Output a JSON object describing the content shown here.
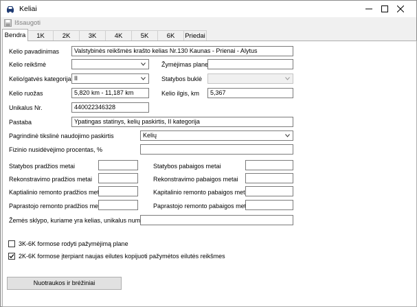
{
  "window": {
    "title": "Keliai"
  },
  "toolbar": {
    "save_label": "Išsaugoti"
  },
  "tabs": [
    "Bendra",
    "1K",
    "2K",
    "3K",
    "4K",
    "5K",
    "6K",
    "Priedai"
  ],
  "form": {
    "kelio_pavadinimas": {
      "label": "Kelio pavadinimas",
      "value": "Valstybinės reikšmės krašto kelias Nr.130 Kaunas - Prienai - Alytus"
    },
    "kelio_reiksme": {
      "label": "Kelio reikšmė",
      "value": ""
    },
    "zymejimas_plane": {
      "label": "Žymėjimas plane",
      "value": ""
    },
    "kategorija": {
      "label": "Kelio/gatvės kategorija",
      "value": "II"
    },
    "statybos_bukle": {
      "label": "Statybos buklė",
      "value": ""
    },
    "kelio_ruozas": {
      "label": "Kelio ruožas",
      "value": "5,820 km - 11,187 km"
    },
    "kelio_ilgis": {
      "label": "Kelio ilgis, km",
      "value": "5,367"
    },
    "unikalus_nr": {
      "label": "Unikalus Nr.",
      "value": "440022346328"
    },
    "pastaba": {
      "label": "Pastaba",
      "value": "Ypatingas statinys, kelių paskirtis, II kategorija"
    },
    "paskirtis": {
      "label": "Pagrindinė tikslinė naudojimo paskirtis",
      "value": "Kelių"
    },
    "nusidevejimas": {
      "label": "Fizinio nusidėvėjimo procentas, %",
      "value": ""
    },
    "statybos_pradzios": {
      "label": "Statybos pradžios metai",
      "value": ""
    },
    "statybos_pabaigos": {
      "label": "Statybos pabaigos metai",
      "value": ""
    },
    "rekonstravimo_pradzios": {
      "label": "Rekonstravimo pradžios metai",
      "value": ""
    },
    "rekonstravimo_pabaigos": {
      "label": "Rekonstravimo pabaigos metai",
      "value": ""
    },
    "kapitalinio_pradzios": {
      "label": "Kaptialinio remonto pradžios metai",
      "value": ""
    },
    "kapitalinio_pabaigos": {
      "label": "Kapitalinio remonto pabaigos metai",
      "value": ""
    },
    "paprastojo_pradzios": {
      "label": "Paprastojo remonto pradžios metai",
      "value": ""
    },
    "paprastojo_pabaigos": {
      "label": "Paprastojo remonto pabaigos metai",
      "value": ""
    },
    "zemes_sklypo": {
      "label": "Žemės sklypo, kuriame yra kelias, unikalus numeris",
      "value": ""
    }
  },
  "options": {
    "show_marking": {
      "label": "3K-6K formose rodyti pažymėjimą plane",
      "checked": false
    },
    "copy_values": {
      "label": "2K-6K formose įterpiant naujas eilutes kopijuoti pažymėtos eilutės reikšmes",
      "checked": true
    }
  },
  "buttons": {
    "photos": "Nuotraukos ir brėžiniai"
  }
}
